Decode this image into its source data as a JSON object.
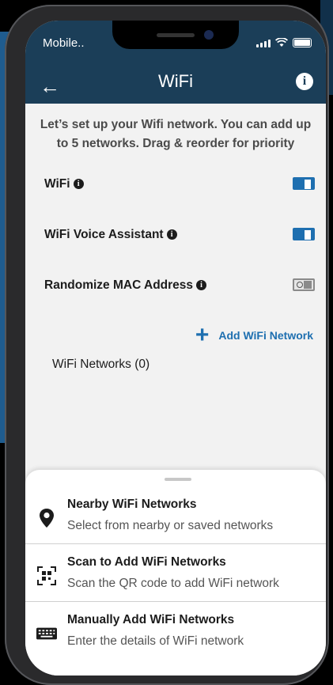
{
  "status": {
    "carrier": "Mobile.."
  },
  "header": {
    "title": "WiFi",
    "back_icon": "arrow-left-icon",
    "info_icon": "info-icon",
    "info_glyph": "i"
  },
  "intro": {
    "text": "Let’s set up your Wifi network. You can add up to 5 networks. Drag & reorder for priority"
  },
  "settings": [
    {
      "label": "WiFi",
      "enabled": true
    },
    {
      "label": "WiFi Voice Assistant",
      "enabled": true
    },
    {
      "label": "Randomize MAC Address",
      "enabled": false
    }
  ],
  "info_glyph": "i",
  "add_network": {
    "label": "Add WiFi Network",
    "icon_glyph": "+"
  },
  "networks": {
    "label": "WiFi Networks (0)"
  },
  "sheet": {
    "options": [
      {
        "title": "Nearby WiFi Networks",
        "subtitle": "Select from nearby or saved networks",
        "icon": "location-pin-icon"
      },
      {
        "title": "Scan to Add WiFi Networks",
        "subtitle": "Scan the QR code to add WiFi network",
        "icon": "qr-scan-icon"
      },
      {
        "title": "Manually Add WiFi Networks",
        "subtitle": "Enter the details of WiFi network",
        "icon": "keyboard-icon"
      }
    ]
  },
  "colors": {
    "header_bg": "#1b3e58",
    "accent": "#1e6fb0",
    "screen_bg": "#f2f2f2"
  }
}
